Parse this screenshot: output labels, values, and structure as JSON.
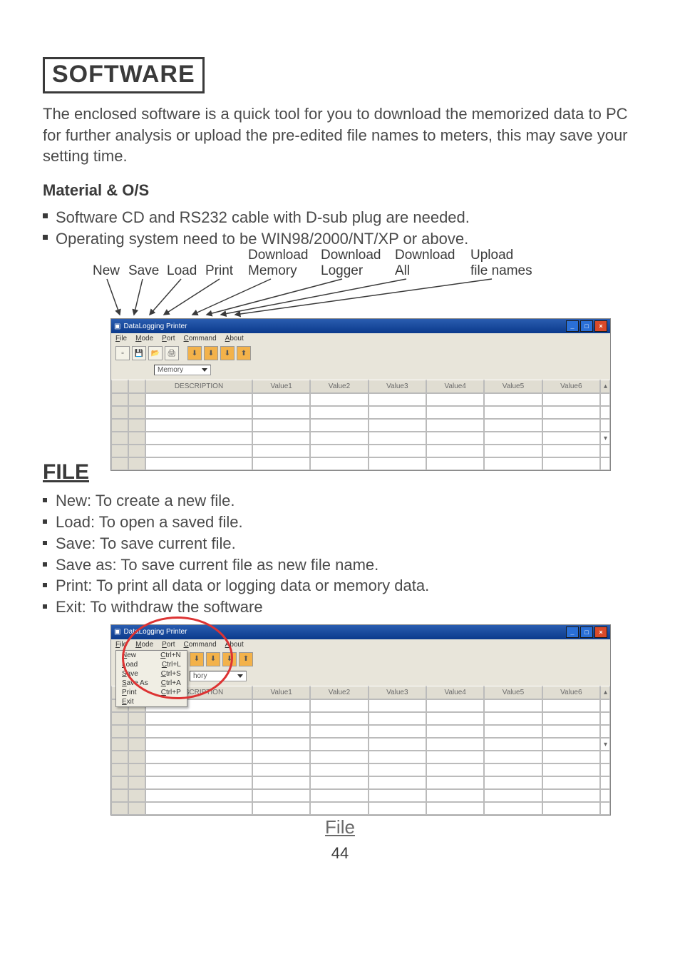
{
  "headings": {
    "software": "SOFTWARE",
    "material": "Material & O/S",
    "file": "FILE"
  },
  "intro": "The enclosed software is a quick tool for you to download the memorized data to PC for further analysis or upload the pre-edited file names to meters, this may save your setting time.",
  "material_bullets": [
    "Software CD and RS232 cable with D-sub plug are needed.",
    "Operating system need to be WIN98/2000/NT/XP or above."
  ],
  "toolbar_labels": {
    "new": "New",
    "save": "Save",
    "load": "Load",
    "print": "Print",
    "dl_memory_1": "Download",
    "dl_memory_2": "Memory",
    "dl_logger_1": "Download",
    "dl_logger_2": "Logger",
    "dl_all_1": "Download",
    "dl_all_2": "All",
    "upload_1": "Upload",
    "upload_2": "file names"
  },
  "app_window": {
    "title": "DataLogging Printer",
    "menus": [
      "File",
      "Mode",
      "Port",
      "Command",
      "About"
    ],
    "dropdown_value": "Memory",
    "columns": [
      "DESCRIPTION",
      "Value1",
      "Value2",
      "Value3",
      "Value4",
      "Value5",
      "Value6"
    ]
  },
  "file_menu": {
    "items": [
      {
        "label": "New",
        "shortcut": "Ctrl+N"
      },
      {
        "label": "Load",
        "shortcut": "Ctrl+L"
      },
      {
        "label": "Save",
        "shortcut": "Ctrl+S"
      },
      {
        "label": "Save As",
        "shortcut": "Ctrl+A"
      },
      {
        "label": "Print",
        "shortcut": "Ctrl+P"
      },
      {
        "label": "Exit",
        "shortcut": ""
      }
    ],
    "dropdown_value": "hory"
  },
  "file_bullets": [
    "New: To create a new file.",
    "Load: To open a saved file.",
    "Save: To save current file.",
    "Save as: To save current file as new file name.",
    "Print: To print all data or logging data or memory data.",
    "Exit: To withdraw the software"
  ],
  "caption_file": "File",
  "page_number": "44"
}
